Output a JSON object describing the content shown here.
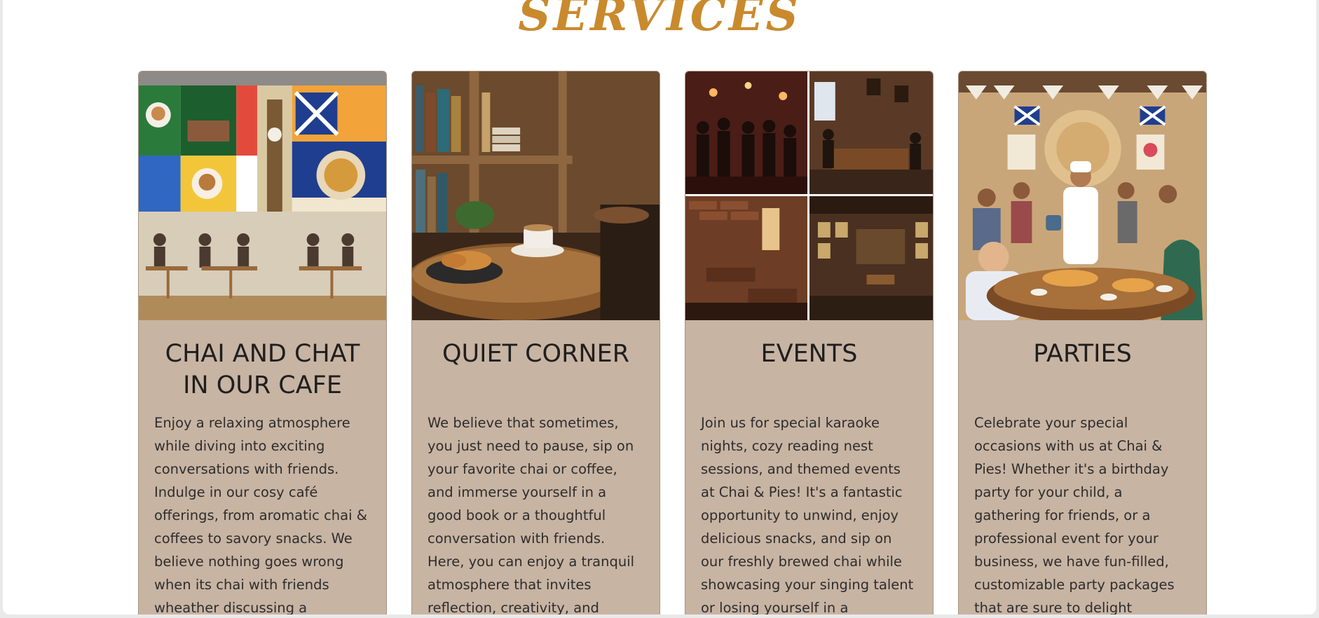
{
  "section": {
    "title": "SERVICES"
  },
  "cards": [
    {
      "title": "CHAI AND CHAT IN OUR CAFE",
      "image_alt": "cafe collage with flags, Big Ben, chai cups and people chatting at tables",
      "text": "Enjoy a relaxing atmosphere while diving into exciting conversations with friends. Indulge in our cosy café offerings, from aromatic chai & coffees to savory snacks. We believe nothing goes wrong when its chai with friends wheather discussing a"
    },
    {
      "title": "QUIET CORNER",
      "image_alt": "bookshelf with a cup of chai and pastries on a wooden table",
      "text": "We believe that sometimes, you just need to pause, sip on your favorite chai or coffee, and immerse yourself in a good book or a thoughtful conversation with friends. Here, you can enjoy a tranquil atmosphere that invites reflection, creativity, and"
    },
    {
      "title": "EVENTS",
      "image_alt": "four photos of karaoke night and cozy cafe interiors",
      "text": "Join us for special karaoke nights, cozy reading nest sessions, and themed events at Chai & Pies! It's a fantastic opportunity to unwind, enjoy delicious snacks, and sip on our freshly brewed chai while showcasing your singing talent or losing yourself in a"
    },
    {
      "title": "PARTIES",
      "image_alt": "festive party with chef pouring chai and guests around a table",
      "text": "Celebrate your special occasions with us at Chai & Pies! Whether it's a birthday party for your child, a gathering for friends, or a professional event for your business, we have fun-filled, customizable party packages that are sure to delight"
    }
  ],
  "colors": {
    "title": "#c98a2d",
    "card_background": "#c8b4a3",
    "text": "#2d2d2d"
  }
}
